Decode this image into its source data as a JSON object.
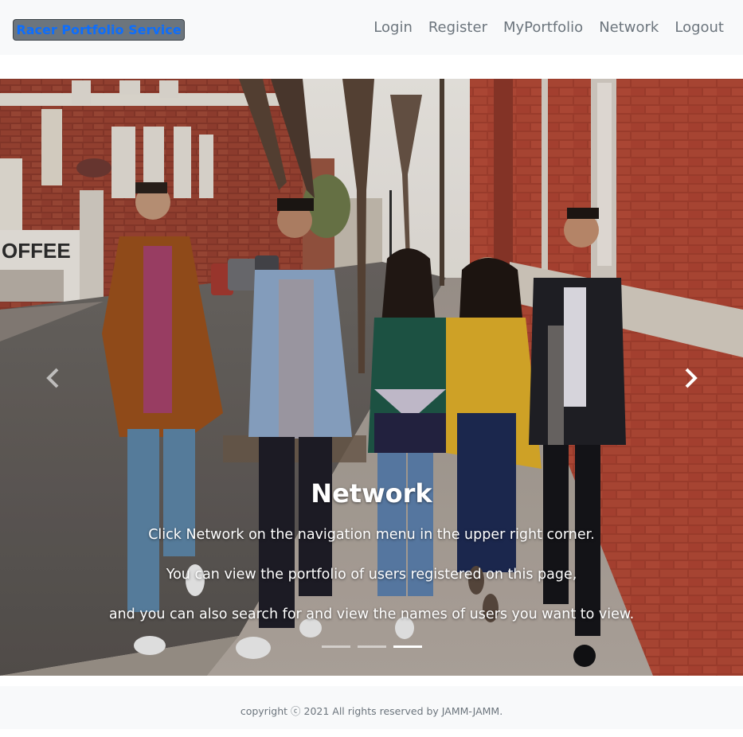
{
  "navbar": {
    "brand": "Racer Portfolio Service",
    "links": [
      "Login",
      "Register",
      "MyPortfolio",
      "Network",
      "Logout"
    ]
  },
  "carousel": {
    "slide_title": "Network",
    "lines": [
      "Click Network on the navigation menu in the upper right corner.",
      "You can view the portfolio of users registered on this page,",
      "and you can also search for and view the names of users you want to view."
    ],
    "active_slide": 3,
    "slide_count": 3
  },
  "footer": {
    "text": "copyright ⓒ 2021 All rights reserved by JAMM-JAMM."
  },
  "colors": {
    "brand_text": "#0d6efd",
    "brand_bg": "#6c757d",
    "nav_link": "#6c757d",
    "navbar_bg": "#f8f9fa"
  },
  "icons": {
    "prev": "chevron-left-icon",
    "next": "chevron-right-icon"
  }
}
